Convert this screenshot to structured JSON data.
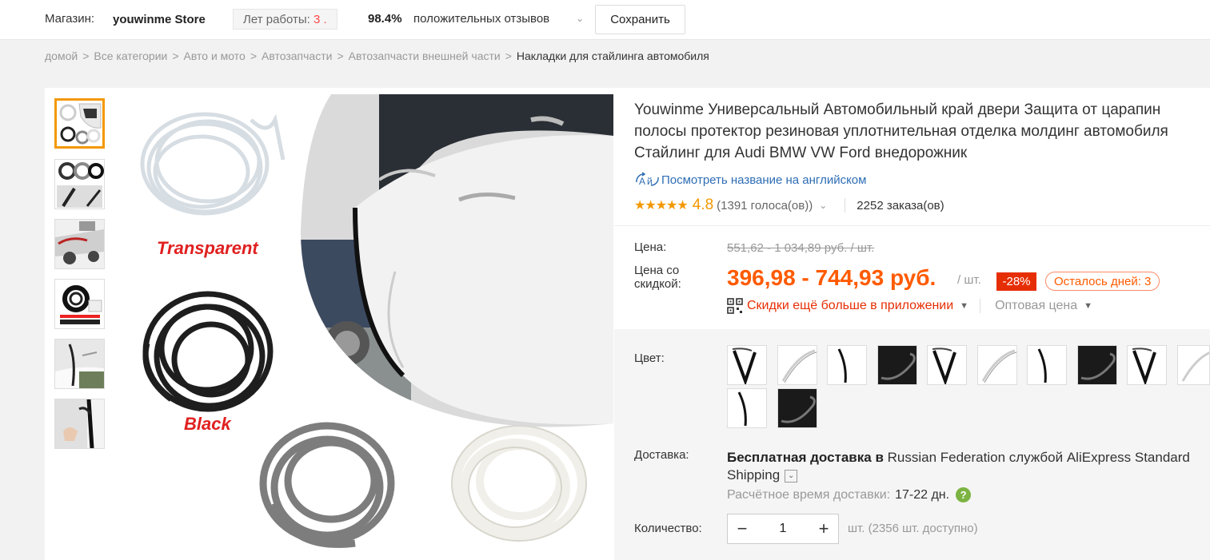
{
  "store": {
    "label": "Магазин:",
    "name": "youwinme Store",
    "years_label": "Лет работы:",
    "years_value": "3 .",
    "feedback_percent": "98.4%",
    "feedback_text": "положительных отзывов",
    "save_label": "Сохранить"
  },
  "breadcrumb": [
    "домой",
    "Все категории",
    "Авто и мото",
    "Автозапчасти",
    "Автозапчасти внешней части",
    "Накладки для стайлинга автомобиля"
  ],
  "product": {
    "title": "Youwinme Универсальный Автомобильный край двери Защита от царапин полосы протектор резиновая уплотнительная отделка молдинг автомобиля Стайлинг для Audi BMW VW Ford внедорожник",
    "translate_label": "Посмотреть название на английском",
    "rating": "4.8",
    "votes": "(1391 голоса(ов))",
    "orders": "2252 заказа(ов)"
  },
  "image_labels": {
    "transparent": "Transparent",
    "black": "Black"
  },
  "price": {
    "label": "Цена:",
    "original": "551,62 - 1 034,89 руб. / шт.",
    "discount_label": "Цена со скидкой:",
    "current": "396,98 - 744,93 руб.",
    "per_unit": "/ шт.",
    "discount_badge": "-28%",
    "days_left": "Осталось дней: 3",
    "app_discount": "Скидки ещё больше в приложении",
    "wholesale": "Оптовая цена"
  },
  "options": {
    "color_label": "Цвет:"
  },
  "shipping": {
    "label": "Доставка:",
    "free": "Бесплатная доставка в",
    "rest": "Russian Federation службой AliExpress Standard Shipping",
    "eta_label": "Расчётное время доставки:",
    "eta_value": "17-22 дн."
  },
  "quantity": {
    "label": "Количество:",
    "value": "1",
    "available": "шт. (2356 шт. доступно)"
  },
  "colors": {
    "accent": "#ff5a00",
    "discount_badge": "#e62e04",
    "link": "#2e6db4",
    "thumb_active": "#f39800"
  }
}
